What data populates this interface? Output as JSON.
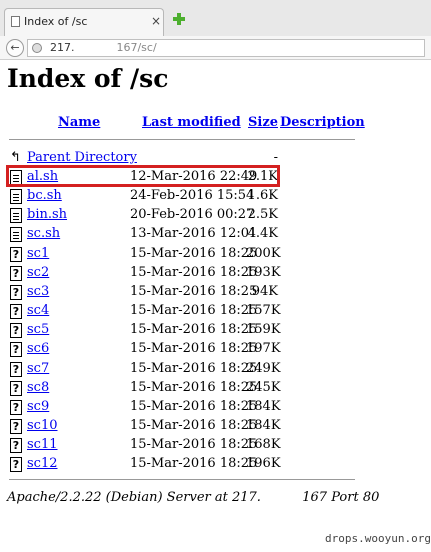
{
  "browser": {
    "tab_title": "Index of /sc",
    "tab_close": "×",
    "back_glyph": "←",
    "url_host": "217.",
    "url_path": "167/sc/"
  },
  "page": {
    "title": "Index of /sc",
    "columns": {
      "name": "Name",
      "modified": "Last modified",
      "size": "Size",
      "description": "Description"
    },
    "parent": {
      "label": "Parent Directory",
      "size": "-"
    },
    "rows": [
      {
        "name": "al.sh",
        "modified": "12-Mar-2016 22:49",
        "size": "2.1K",
        "icon": "text-file-icon"
      },
      {
        "name": "bc.sh",
        "modified": "24-Feb-2016 15:54",
        "size": "1.6K",
        "icon": "text-file-icon"
      },
      {
        "name": "bin.sh",
        "modified": "20-Feb-2016 00:27",
        "size": "2.5K",
        "icon": "text-file-icon"
      },
      {
        "name": "sc.sh",
        "modified": "13-Mar-2016 12:01",
        "size": "4.4K",
        "icon": "text-file-icon"
      },
      {
        "name": "sc1",
        "modified": "15-Mar-2016 18:25",
        "size": "200K",
        "icon": "unknown-file-icon"
      },
      {
        "name": "sc2",
        "modified": "15-Mar-2016 18:25",
        "size": "193K",
        "icon": "unknown-file-icon"
      },
      {
        "name": "sc3",
        "modified": "15-Mar-2016 18:25",
        "size": "94K",
        "icon": "unknown-file-icon"
      },
      {
        "name": "sc4",
        "modified": "15-Mar-2016 18:25",
        "size": "157K",
        "icon": "unknown-file-icon"
      },
      {
        "name": "sc5",
        "modified": "15-Mar-2016 18:25",
        "size": "159K",
        "icon": "unknown-file-icon"
      },
      {
        "name": "sc6",
        "modified": "15-Mar-2016 18:25",
        "size": "197K",
        "icon": "unknown-file-icon"
      },
      {
        "name": "sc7",
        "modified": "15-Mar-2016 18:25",
        "size": "249K",
        "icon": "unknown-file-icon"
      },
      {
        "name": "sc8",
        "modified": "15-Mar-2016 18:25",
        "size": "245K",
        "icon": "unknown-file-icon"
      },
      {
        "name": "sc9",
        "modified": "15-Mar-2016 18:25",
        "size": "184K",
        "icon": "unknown-file-icon"
      },
      {
        "name": "sc10",
        "modified": "15-Mar-2016 18:25",
        "size": "184K",
        "icon": "unknown-file-icon"
      },
      {
        "name": "sc11",
        "modified": "15-Mar-2016 18:25",
        "size": "168K",
        "icon": "unknown-file-icon"
      },
      {
        "name": "sc12",
        "modified": "15-Mar-2016 18:25",
        "size": "196K",
        "icon": "unknown-file-icon"
      }
    ],
    "highlight_color": "#d42020",
    "footer_prefix": "Apache/2.2.22 (Debian) Server at 217.",
    "footer_suffix": "167 Port 80"
  },
  "watermark": "drops.wooyun.org"
}
